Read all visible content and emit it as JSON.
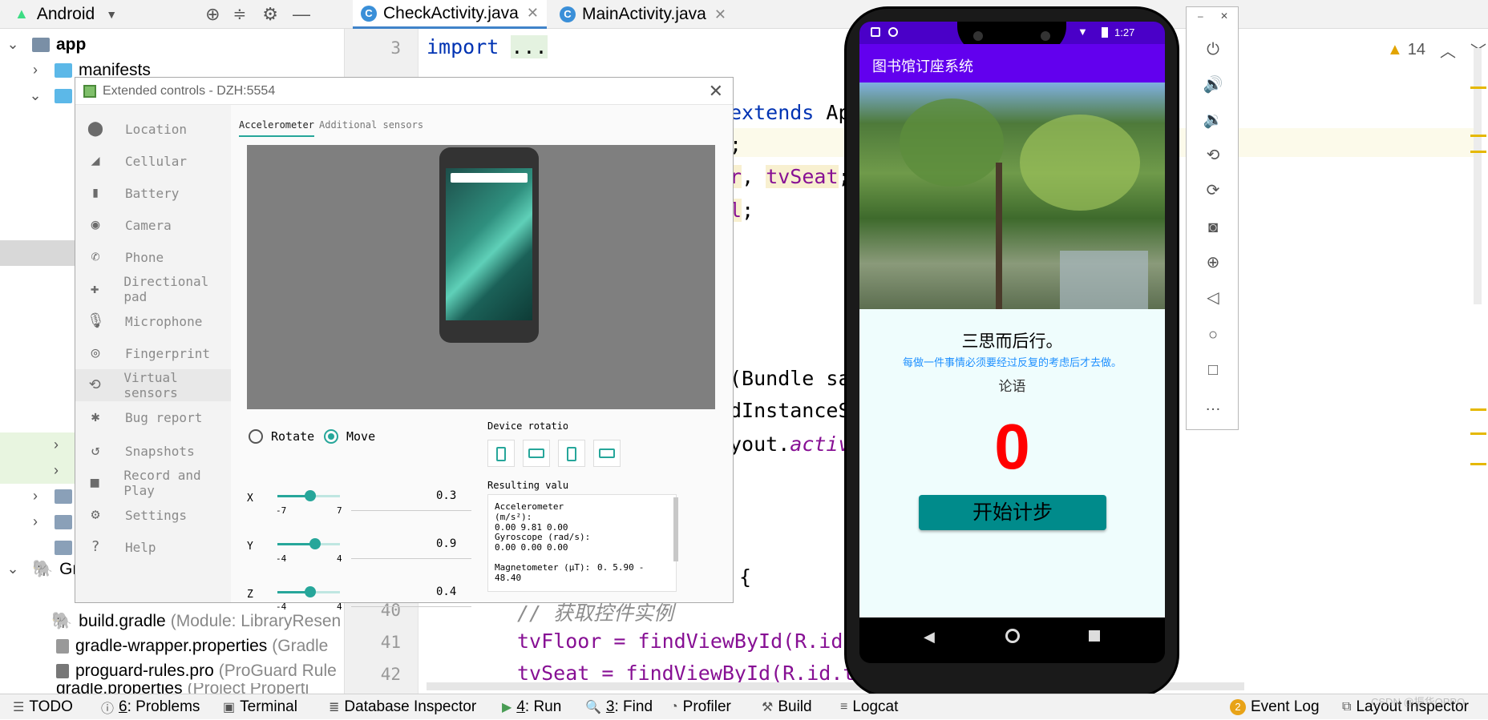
{
  "project": {
    "view_label": "Android",
    "tree": [
      {
        "label": "app",
        "bold": true
      },
      {
        "label": "manifests"
      },
      {
        "label": "Gra"
      },
      {
        "label": "build.gradle",
        "extra": "(Module: LibraryResen"
      },
      {
        "label": "gradle-wrapper.properties",
        "extra": "(Gradle"
      },
      {
        "label": "proguard-rules.pro",
        "extra": "(ProGuard Rule"
      },
      {
        "label": "gradle.properties",
        "extra": "(Project Properti"
      }
    ]
  },
  "tabs": [
    {
      "label": "CheckActivity.java",
      "active": true
    },
    {
      "label": "MainActivity.java",
      "active": false
    }
  ],
  "editor": {
    "line_numbers": [
      "3",
      "40",
      "41",
      "42"
    ],
    "import_kw": "import",
    "import_dots": "...",
    "extends_kw": "extends",
    "extends_rest": "App",
    "semicolon1": ";",
    "r_frag": "r",
    "comma": ",",
    "tvseat_decl": "tvSeat",
    "semicolon2": ";",
    "l_frag": "l",
    "semicolon3": ";",
    "bundle_frag": "(Bundle sav",
    "instance_frag": "dInstanceSt",
    "layout_frag": "yout.",
    "activ_frag": "activ",
    "brace": "{",
    "comment": "// 获取控件实例",
    "line41": "tvFloor = findViewById(R.id.t",
    "line42": "tvSeat = findViewById(R.id.tv_",
    "warnings": "14"
  },
  "extended_controls": {
    "title": "Extended controls - DZH:5554",
    "sidebar": [
      {
        "label": "Location",
        "icon": "location-icon",
        "glyph": "⬤"
      },
      {
        "label": "Cellular",
        "icon": "cellular-icon",
        "glyph": "◢"
      },
      {
        "label": "Battery",
        "icon": "battery-icon",
        "glyph": "▮"
      },
      {
        "label": "Camera",
        "icon": "camera-icon",
        "glyph": "◉"
      },
      {
        "label": "Phone",
        "icon": "phone-icon",
        "glyph": "✆"
      },
      {
        "label": "Directional pad",
        "icon": "dpad-icon",
        "glyph": "✚"
      },
      {
        "label": "Microphone",
        "icon": "microphone-icon",
        "glyph": "🎙"
      },
      {
        "label": "Fingerprint",
        "icon": "fingerprint-icon",
        "glyph": "◎"
      },
      {
        "label": "Virtual sensors",
        "icon": "virtual-sensors-icon",
        "glyph": "⟲"
      },
      {
        "label": "Bug report",
        "icon": "bug-icon",
        "glyph": "✱"
      },
      {
        "label": "Snapshots",
        "icon": "snapshots-icon",
        "glyph": "↺"
      },
      {
        "label": "Record and Play",
        "icon": "record-icon",
        "glyph": "■"
      },
      {
        "label": "Settings",
        "icon": "settings-icon",
        "glyph": "⚙"
      },
      {
        "label": "Help",
        "icon": "help-icon",
        "glyph": "?"
      }
    ],
    "tab_accel": "Accelerometer",
    "tab_additional": "Additional sensors",
    "rotate_label": "Rotate",
    "move_label": "Move",
    "device_rotation_label": "Device rotation",
    "resulting_label": "Resulting value",
    "sliders": [
      {
        "axis": "X",
        "min": "-7",
        "max": "7",
        "value": "0.3",
        "frac": 0.52
      },
      {
        "axis": "Y",
        "min": "-4",
        "max": "4",
        "value": "0.9",
        "frac": 0.6
      },
      {
        "axis": "Z",
        "min": "-4",
        "max": "4",
        "value": "0.4",
        "frac": 0.53
      }
    ],
    "results": [
      {
        "name": "Accelerometer (m/s²):",
        "v1": "0.00",
        "v2": "9.81",
        "v3": "0.00"
      },
      {
        "name": "Gyroscope (rad/s):",
        "v1": "0.00",
        "v2": "0.00",
        "v3": "0.00"
      },
      {
        "name": "Magnetometer (μT):",
        "v1": "0.",
        "v2": "5.90",
        "v3": "-48.40"
      }
    ]
  },
  "phone": {
    "status_time": "1:27",
    "app_title": "图书馆订座系统",
    "quote": "三思而后行。",
    "quote_explain": "每做一件事情必须要经过反复的考虑后才去做。",
    "quote_source": "论语",
    "step_count": "0",
    "start_button": "开始计步",
    "accent": "#6200ee",
    "count_color": "#ff0000",
    "button_color": "#008b8b"
  },
  "bottom_bar": {
    "todo": "TODO",
    "problems_num": "6",
    "problems": ": Problems",
    "terminal": "Terminal",
    "database": "Database Inspector",
    "run_num": "4",
    "run": ": Run",
    "find_num": "3",
    "find": ": Find",
    "profiler": "Profiler",
    "build": "Build",
    "logcat": "Logcat",
    "event_count": "2",
    "event_log": "Event Log",
    "layout_inspector": "Layout Inspector",
    "watermark": "CSDN @振华OPPO"
  }
}
